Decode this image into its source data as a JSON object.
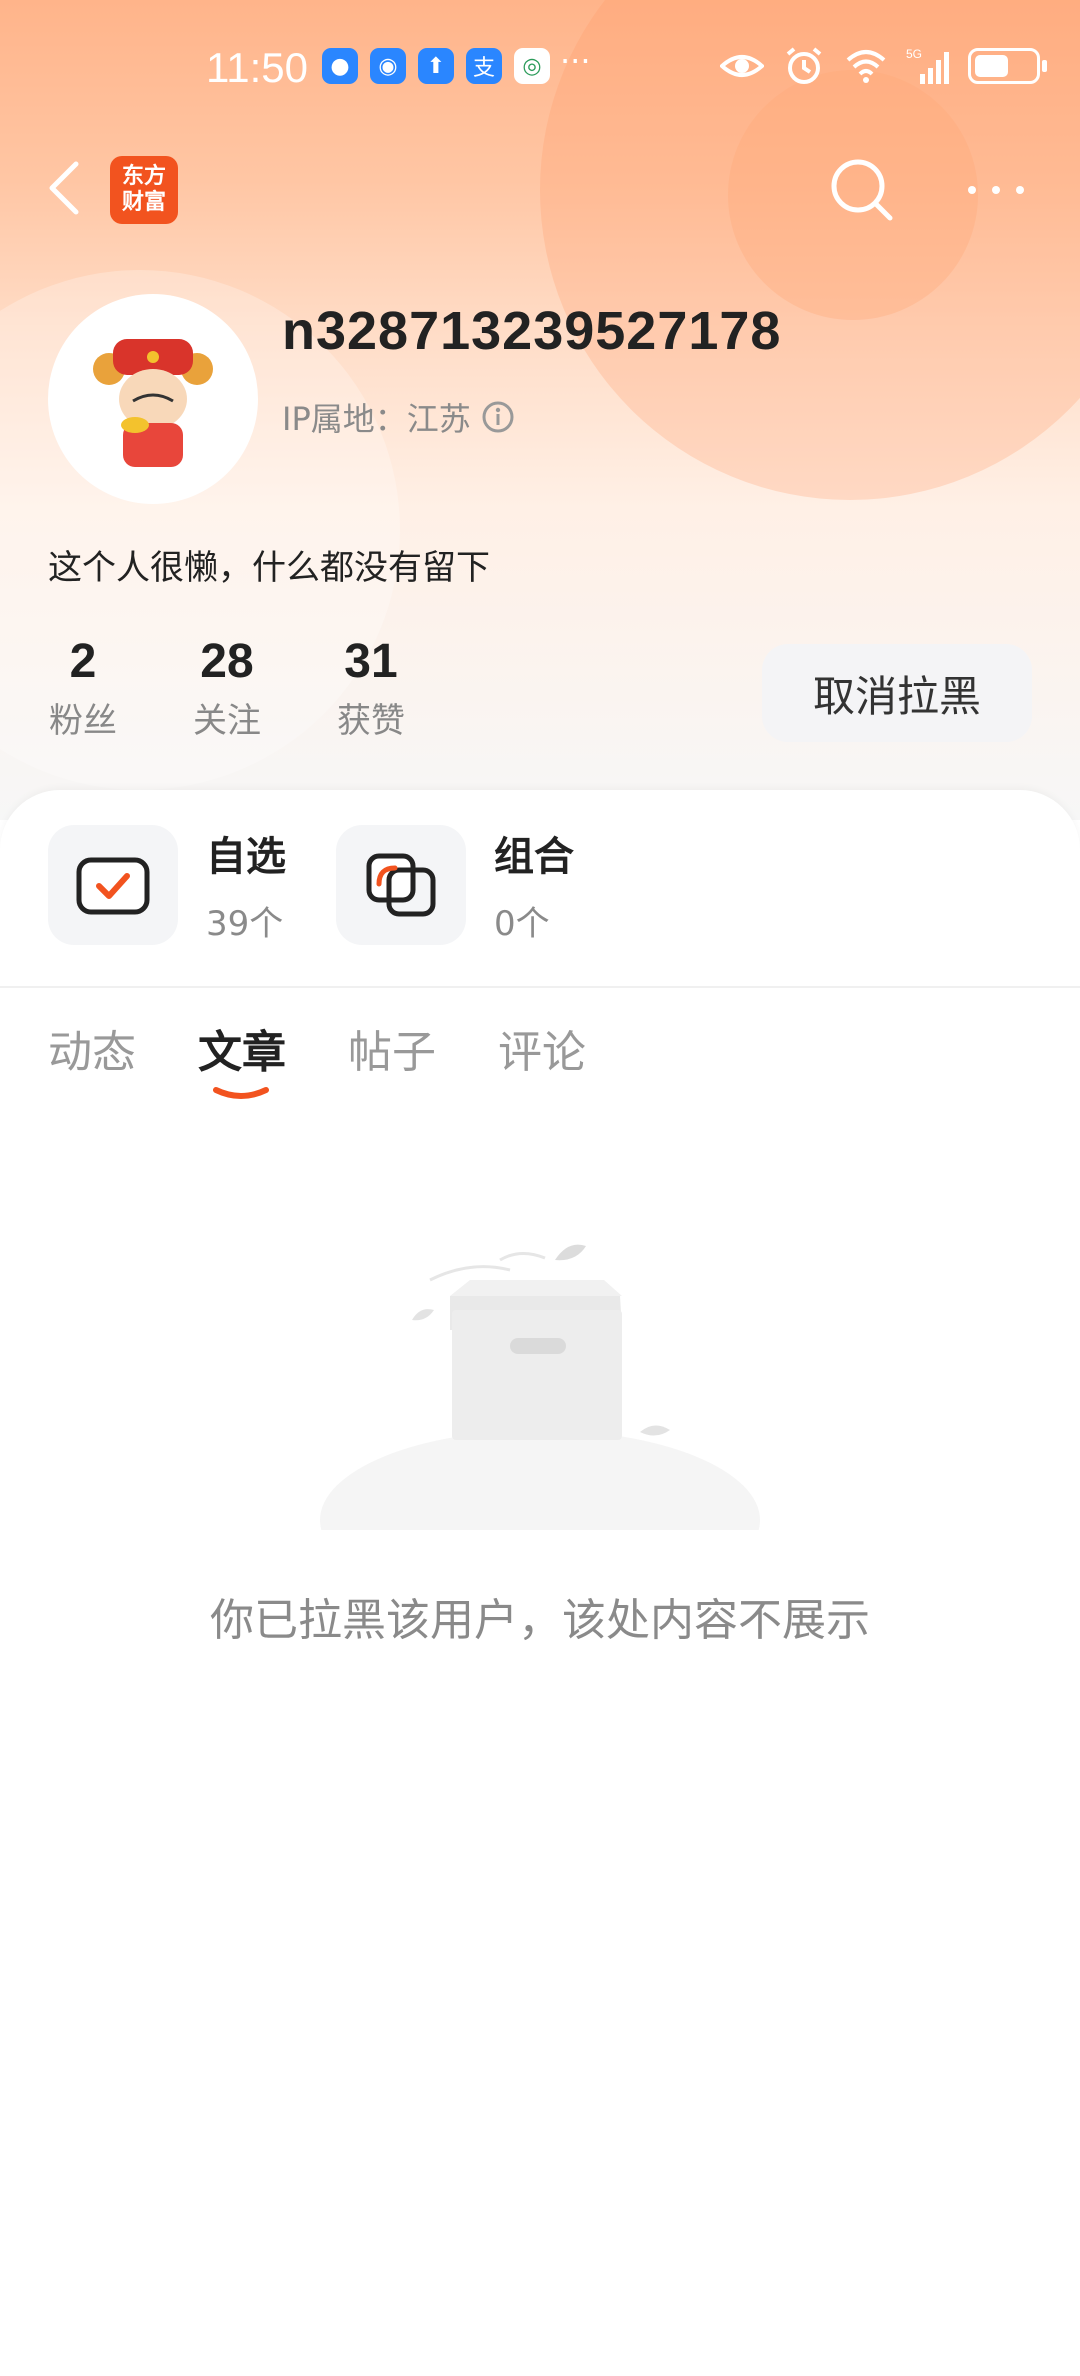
{
  "status_bar": {
    "time": "11:50",
    "network": "5G",
    "battery_level": 0.55
  },
  "nav": {
    "logo_text_line1": "东方",
    "logo_text_line2": "财富"
  },
  "profile": {
    "username": "n328713239527178",
    "ip_label": "IP属地：江苏",
    "bio": "这个人很懒，什么都没有留下"
  },
  "stats": [
    {
      "value": "2",
      "label": "粉丝"
    },
    {
      "value": "28",
      "label": "关注"
    },
    {
      "value": "31",
      "label": "获赞"
    }
  ],
  "actions": {
    "unblock_label": "取消拉黑"
  },
  "quick": [
    {
      "title": "自选",
      "sub": "39个"
    },
    {
      "title": "组合",
      "sub": "0个"
    }
  ],
  "tabs": [
    {
      "label": "动态"
    },
    {
      "label": "文章"
    },
    {
      "label": "帖子"
    },
    {
      "label": "评论"
    }
  ],
  "empty_state": {
    "message": "你已拉黑该用户，该处内容不展示"
  },
  "colors": {
    "accent": "#f2531f",
    "hero_top": "#ffb48a"
  }
}
